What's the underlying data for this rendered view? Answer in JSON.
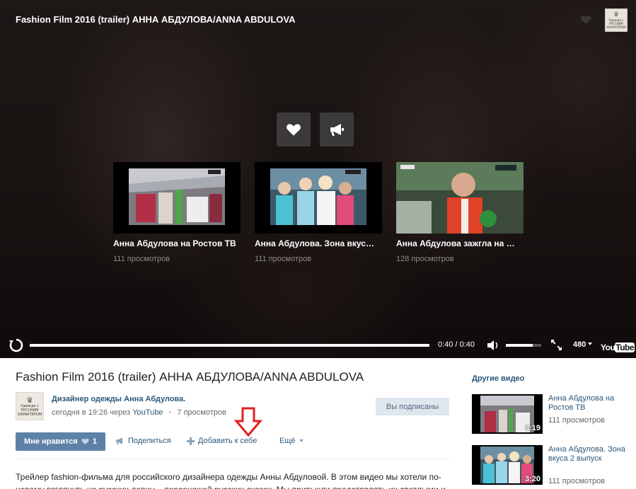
{
  "player": {
    "title": "Fashion Film 2016 (trailer) АННА АБДУЛОВА/ANNA ABDULOVA",
    "logo_lines": [
      "Одежда с",
      "РУССКИМ",
      "ХАРАКТЕРОМ"
    ],
    "suggestions": [
      {
        "title": "Анна Абдулова на Ростов ТВ",
        "views": "111 просмотров"
      },
      {
        "title": "Анна Абдулова. Зона вкус…",
        "views": "111 просмотров"
      },
      {
        "title": "Анна Абдулова зажгла на …",
        "views": "128 просмотров"
      }
    ],
    "time": "0:40 / 0:40",
    "progress": 1.0,
    "volume": 0.75,
    "quality": "480",
    "yt_you": "You",
    "yt_tube": "Tube"
  },
  "video": {
    "title": "Fashion Film 2016 (trailer) АННА АБДУЛОВА/ANNA ABDULOVA",
    "author": "Дизайнер одежды Анна Абдулова.",
    "avatar_lines": [
      "Одежда с",
      "РУССКИМ",
      "ХАРАКТЕРОМ"
    ],
    "date": "сегодня в 19:26 через",
    "source": "YouTube",
    "views": "7 просмотров",
    "subscribed_label": "Вы подписаны",
    "like_label": "Мне нравится",
    "like_count": "1",
    "share_label": "Поделиться",
    "add_label": "Добавить к себе",
    "more_label": "Ещё",
    "description": "Трейлер fashion-фильма для российского дизайнера одежды Анны Абдуловой. В этом видео мы хотели по-новому взглянуть на русских девиц – персонажей русских сказок. Мы привыкли представлять их светлыми и"
  },
  "other_videos": {
    "title": "Другие видео",
    "items": [
      {
        "title": "Анна Абдулова на Ростов ТВ",
        "duration": "3:19",
        "views": "111 просмотров"
      },
      {
        "title": "Анна Абдулова. Зона вкуса 2 выпуск",
        "duration": "3:20",
        "views": "111 просмотров"
      }
    ]
  },
  "colors": {
    "link": "#2b587a",
    "like_button": "#5e81a8",
    "subscribed_button": "#dfe6ed",
    "annotation_arrow": "#e02020"
  }
}
